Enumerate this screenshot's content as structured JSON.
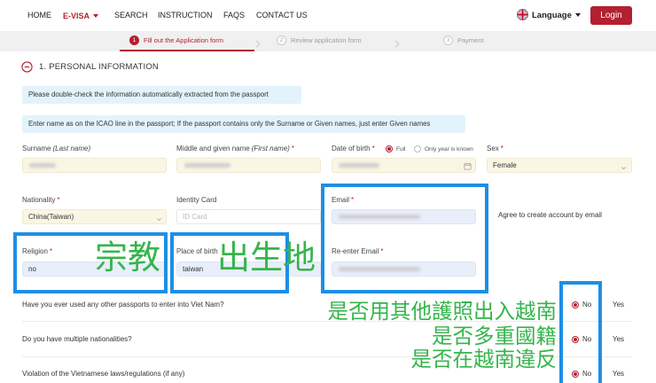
{
  "nav": {
    "items": [
      {
        "label": "HOME"
      },
      {
        "label": "E-VISA"
      },
      {
        "label": "SEARCH"
      },
      {
        "label": "INSTRUCTION"
      },
      {
        "label": "FAQS"
      },
      {
        "label": "CONTACT US"
      }
    ],
    "language_label": "Language",
    "login_label": "Login"
  },
  "steps": [
    {
      "number": "1",
      "label": "Fill out the Application form",
      "active": true
    },
    {
      "number": "2",
      "label": "Review application form",
      "active": false
    },
    {
      "number": "3",
      "label": "Payment",
      "active": false
    }
  ],
  "section": {
    "title": "1. PERSONAL INFORMATION"
  },
  "notices": [
    "Please double-check the information automatically extracted from the passport",
    "Enter name as on the ICAO line in the passport; If the passport contains only the Surname or Given names, just enter Given names"
  ],
  "required_mark": "*",
  "fields": {
    "surname": {
      "label": "Surname",
      "hint": "(Last name)"
    },
    "given_name": {
      "label": "Middle and given name",
      "hint": "(First name)"
    },
    "date_of_birth": {
      "label": "Date of birth",
      "option_full": "Full",
      "option_year_only": "Only year is known",
      "full_selected": true
    },
    "sex": {
      "label": "Sex",
      "value": "Female"
    },
    "nationality": {
      "label": "Nationality",
      "value": "China(Taiwan)"
    },
    "identity_card": {
      "label": "Identity Card",
      "placeholder": "ID Card"
    },
    "email": {
      "label": "Email"
    },
    "agree_account": {
      "label": "Agree to create account by email"
    },
    "religion": {
      "label": "Religion",
      "value": "no"
    },
    "place_of_birth": {
      "label": "Place of birth",
      "value": "taiwan"
    },
    "reenter_email": {
      "label": "Re-enter Email"
    }
  },
  "questions": [
    {
      "text": "Have you ever used any other passports to enter into Viet Nam?",
      "no_label": "No",
      "yes_label": "Yes",
      "no_selected": true
    },
    {
      "text": "Do you have multiple nationalities?",
      "no_label": "No",
      "yes_label": "Yes",
      "no_selected": true
    },
    {
      "text": "Violation of the Vietnamese laws/regulations (if any)",
      "no_label": "No",
      "yes_label": "Yes",
      "no_selected": true
    }
  ],
  "annotations": {
    "religion_note": "宗教",
    "place_of_birth_note": "出生地",
    "other_passports_note": "是否用其他護照出入越南",
    "multiple_nationalities_note": "是否多重國籍",
    "violation_note": "是否在越南違反"
  },
  "icons": {
    "language_flag": "uk-flag-icon",
    "nav_dropdown": "caret-down-icon",
    "step_separator": "chevron-right-icon",
    "section_toggle": "minus-circle-icon",
    "date_picker": "calendar-icon",
    "select_dropdown": "chevron-down-icon"
  },
  "colors": {
    "brand_red": "#b3202f",
    "annotation_blue": "#1d8fe6",
    "annotation_green": "#35b54b",
    "notice_bg": "#e3f3fb",
    "input_cream": "#fbf6e3",
    "input_autofill": "#e8eefa"
  }
}
